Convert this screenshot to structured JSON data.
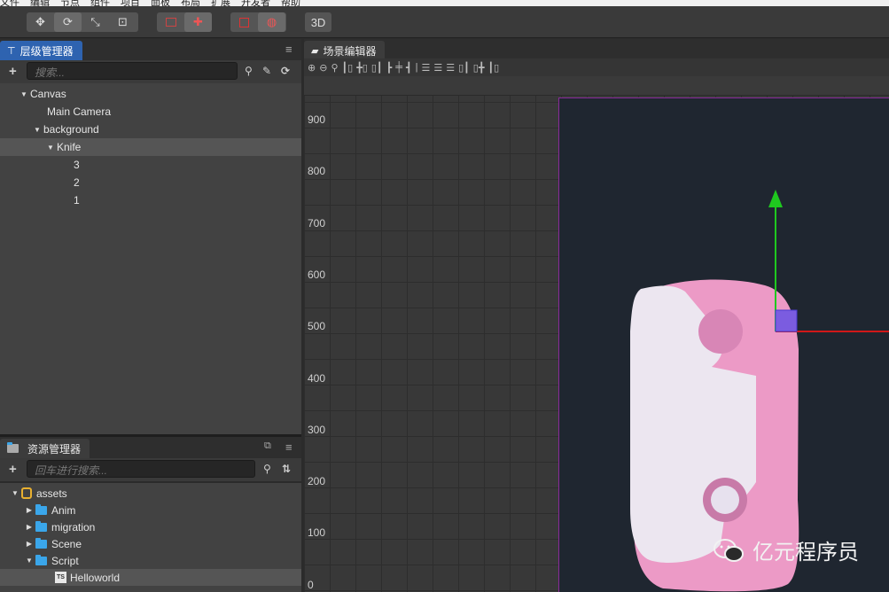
{
  "menubar": {
    "items": [
      "文件",
      "编辑",
      "节点",
      "组件",
      "项目",
      "面板",
      "布局",
      "扩展",
      "开发者",
      "帮助"
    ]
  },
  "toolbar": {
    "transform_tools": [
      "move-tool",
      "rotate-tool",
      "scale-tool",
      "rect-tool"
    ],
    "view_3d_label": "3D"
  },
  "hierarchy": {
    "tab_label": "层级管理器",
    "search_placeholder": "搜索...",
    "nodes": [
      {
        "label": "Canvas",
        "level": 0,
        "expanded": true
      },
      {
        "label": "Main Camera",
        "level": 1,
        "expanded": null
      },
      {
        "label": "background",
        "level": 1,
        "expanded": true
      },
      {
        "label": "Knife",
        "level": 2,
        "expanded": true,
        "selected": true
      },
      {
        "label": "3",
        "level": 3,
        "expanded": null
      },
      {
        "label": "2",
        "level": 3,
        "expanded": null
      },
      {
        "label": "1",
        "level": 3,
        "expanded": null
      }
    ]
  },
  "assets": {
    "tab_label": "资源管理器",
    "search_placeholder": "回车进行搜索...",
    "items": [
      {
        "label": "assets",
        "type": "root",
        "expanded": true
      },
      {
        "label": "Anim",
        "type": "folder",
        "expanded": false
      },
      {
        "label": "migration",
        "type": "folder",
        "expanded": false
      },
      {
        "label": "Scene",
        "type": "folder",
        "expanded": false
      },
      {
        "label": "Script",
        "type": "folder",
        "expanded": true
      },
      {
        "label": "Helloworld",
        "type": "ts",
        "selected": true
      }
    ]
  },
  "scene": {
    "tab_label": "场景编辑器",
    "y_ruler_labels": [
      "900",
      "800",
      "700",
      "600",
      "500",
      "400",
      "300",
      "200",
      "100",
      "0"
    ]
  },
  "watermark": {
    "text": "亿元程序员"
  },
  "colors": {
    "accent_tab": "#2e63b0",
    "canvas_bg": "#1f2630",
    "canvas_border": "#8a2a9a",
    "gizmo_x": "#d01818",
    "gizmo_y": "#1fc81f",
    "knife_pink": "#ec9ac6",
    "knife_white": "#ece6f0"
  }
}
